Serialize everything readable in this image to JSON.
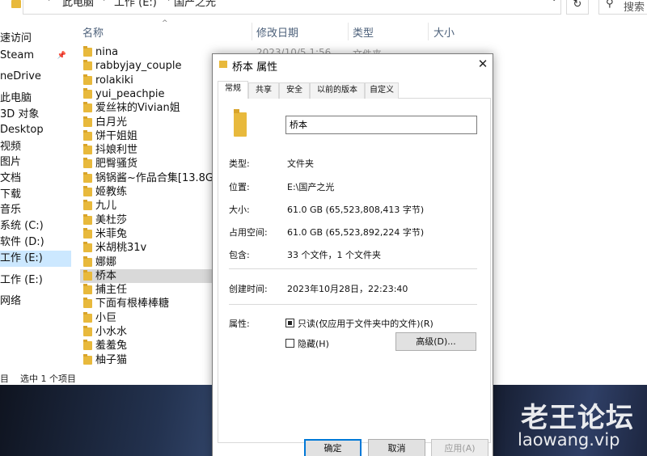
{
  "address_bar": {
    "crumbs": [
      "此电脑",
      "工作 (E:)",
      "国产之光"
    ],
    "search_placeholder": "搜索"
  },
  "nav": {
    "items": [
      "速访问",
      "Steam",
      "neDrive",
      "此电脑",
      "3D 对象",
      "Desktop",
      "视频",
      "图片",
      "文档",
      "下载",
      "音乐",
      "系统 (C:)",
      "软件 (D:)",
      "工作 (E:)",
      "工作 (E:)",
      "网络"
    ],
    "selected_index": 13
  },
  "columns": {
    "name": "名称",
    "date": "修改日期",
    "type": "类型",
    "size": "大小"
  },
  "faded_row": {
    "date": "2023/10/5 1:56",
    "type": "文件夹"
  },
  "files": [
    "nina",
    "rabbyjay_couple",
    "rolakiki",
    "yui_peachpie",
    "爱丝袜的Vivian姐",
    "白月光",
    "饼干姐姐",
    "抖娘利世",
    "肥臀骚货",
    "锅锅酱~作品合集[13.8G]",
    "姬教练",
    "九儿",
    "美杜莎",
    "米菲兔",
    "米胡桃31v",
    "娜娜",
    "桥本",
    "捕主任",
    "下面有根棒棒糖",
    "小巨",
    "小水水",
    "羞羞兔",
    "柚子猫"
  ],
  "selected_file_index": 16,
  "status": {
    "count": "目",
    "selection": "选中 1 个项目"
  },
  "watermark": {
    "line1": "老王论坛",
    "line2": "laowang.vip"
  },
  "dialog": {
    "title": "桥本 属性",
    "tabs": [
      "常规",
      "共享",
      "安全",
      "以前的版本",
      "自定义"
    ],
    "active_tab": 0,
    "folder_name": "桥本",
    "props": [
      {
        "label": "类型:",
        "value": "文件夹"
      },
      {
        "label": "位置:",
        "value": "E:\\国产之光"
      },
      {
        "label": "大小:",
        "value": "61.0 GB (65,523,808,413 字节)"
      },
      {
        "label": "占用空间:",
        "value": "61.0 GB (65,523,892,224 字节)"
      },
      {
        "label": "包含:",
        "value": "33 个文件，1 个文件夹"
      },
      {
        "label": "创建时间:",
        "value": "2023年10月28日，22:23:40"
      }
    ],
    "attributes_label": "属性:",
    "readonly_label": "只读(仅应用于文件夹中的文件)(R)",
    "readonly_checked": true,
    "hidden_label": "隐藏(H)",
    "hidden_checked": false,
    "advanced_button": "高级(D)...",
    "ok_button": "确定",
    "cancel_button": "取消",
    "apply_button": "应用(A)"
  }
}
